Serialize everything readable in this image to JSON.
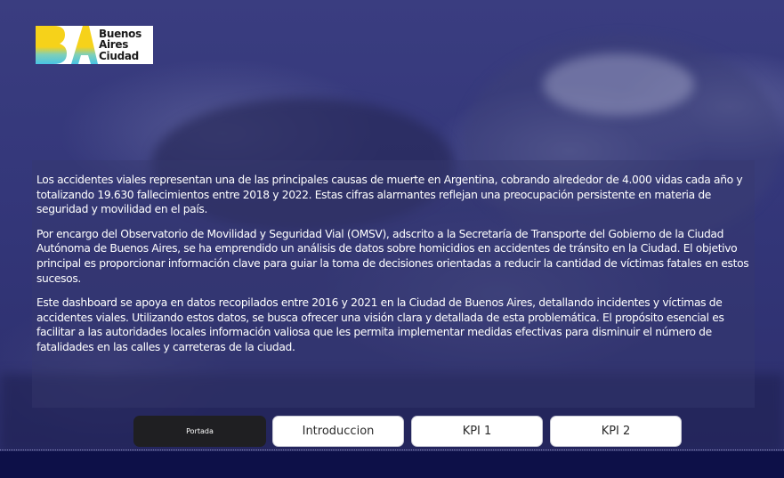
{
  "logo": {
    "text_line1": "Buenos",
    "text_line2": "Aires",
    "text_line3": "Ciudad",
    "colors": {
      "yellow": "#F6D21A",
      "cyan": "#49C4E4"
    }
  },
  "intro_paragraphs": [
    "Los accidentes viales representan una de las principales causas de muerte en Argentina, cobrando alrededor de 4.000 vidas cada año y totalizando 19.630 fallecimientos entre 2018 y 2022. Estas cifras alarmantes reflejan una preocupación persistente en materia de seguridad y movilidad en el país.",
    "Por encargo del Observatorio de Movilidad y Seguridad Vial (OMSV), adscrito a la Secretaría de Transporte del Gobierno de la Ciudad Autónoma de Buenos Aires, se ha emprendido un análisis de datos sobre homicidios en accidentes de tránsito en la Ciudad. El objetivo principal es proporcionar información clave para guiar la toma de decisiones orientadas a reducir la cantidad de víctimas fatales en estos sucesos.",
    "Este dashboard se apoya en datos recopilados entre 2016 y 2021 en la Ciudad de Buenos Aires, detallando incidentes y víctimas de accidentes viales. Utilizando estos datos, se busca ofrecer una visión clara y detallada de esta problemática. El propósito esencial es facilitar a las autoridades locales información valiosa que les permita implementar medidas efectivas para disminuir el número de fatalidades en las calles y carreteras de la ciudad."
  ],
  "nav": {
    "portada": "Portada",
    "introduccion": "Introduccion",
    "kpi1": "KPI 1",
    "kpi2": "KPI 2",
    "active": "Portada"
  },
  "theme": {
    "background": "#2f3170",
    "footer": "#0d1048",
    "active_button": "#1f1f22"
  }
}
